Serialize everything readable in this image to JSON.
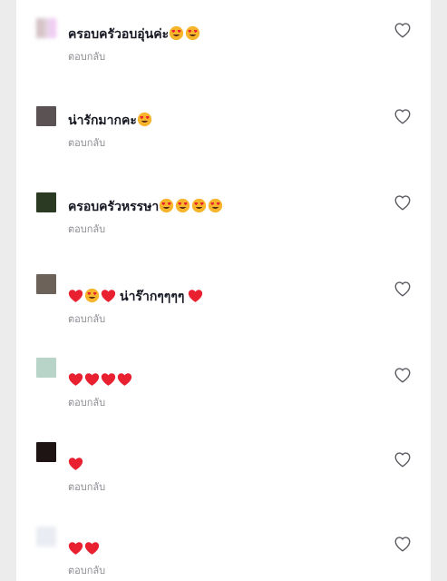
{
  "comments": [
    {
      "avatar_color": "#c9b0b6",
      "text": "ครอบครัวอบอุ่นค่ะ",
      "trailing_emoji": [
        "heart-eyes",
        "heart-eyes"
      ],
      "reply_label": "ตอบกลับ"
    },
    {
      "avatar_color": "#5a5253",
      "text": "น่ารักมากคะ",
      "trailing_emoji": [
        "heart-eyes"
      ],
      "reply_label": "ตอบกลับ"
    },
    {
      "avatar_color": "#2b3a22",
      "text": "ครอบครัวหรรษา",
      "trailing_emoji": [
        "heart-eyes",
        "heart-eyes",
        "heart-eyes",
        "heart-eyes"
      ],
      "reply_label": "ตอบกลับ"
    },
    {
      "avatar_color": "#6d6259",
      "leading_emoji": [
        "red-heart",
        "heart-eyes",
        "red-heart"
      ],
      "text": "น่าร๊ากๆๆๆๆ",
      "trailing_emoji": [
        "red-heart"
      ],
      "reply_label": "ตอบกลับ"
    },
    {
      "avatar_color": "#b8d4c8",
      "trailing_emoji": [
        "red-heart",
        "red-heart",
        "red-heart",
        "red-heart"
      ],
      "reply_label": "ตอบกลับ"
    },
    {
      "avatar_color": "#1e1414",
      "trailing_emoji": [
        "red-heart"
      ],
      "reply_label": "ตอบกลับ"
    },
    {
      "avatar_color": "#e6e9f0",
      "trailing_emoji": [
        "red-heart",
        "red-heart"
      ],
      "reply_label": "ตอบกลับ"
    }
  ],
  "icons": {
    "like": "heart-outline-icon",
    "red_heart": "red-heart-emoji",
    "heart_eyes": "heart-eyes-emoji"
  },
  "colors": {
    "text_primary": "#161823",
    "text_secondary": "#8a8b91",
    "heart_red": "#e8202f",
    "emoji_yellow": "#f7b52c"
  }
}
